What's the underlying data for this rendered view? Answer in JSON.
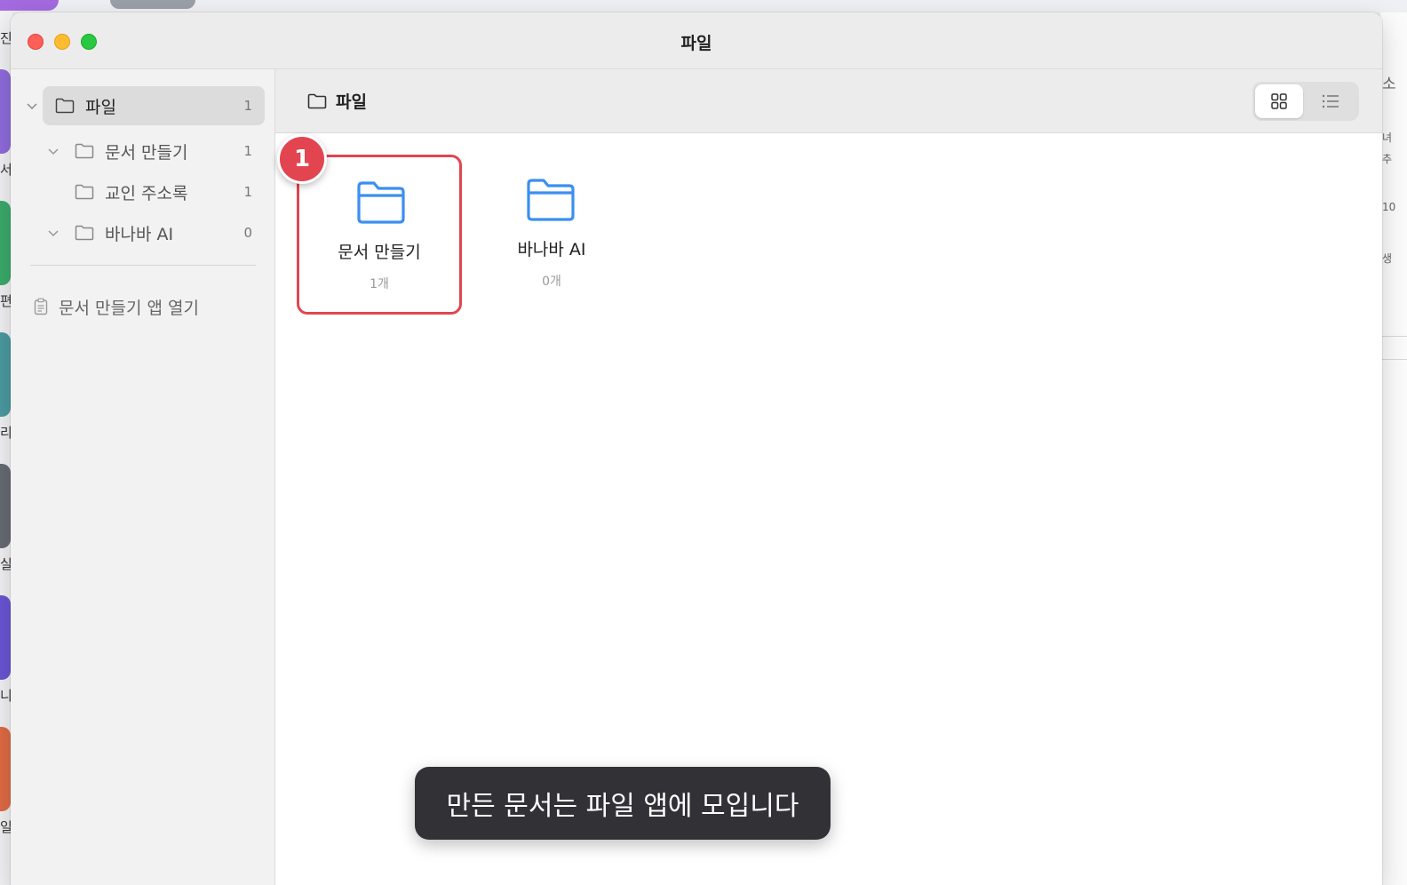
{
  "window": {
    "title": "파일"
  },
  "sidebar": {
    "root": {
      "label": "파일",
      "count": "1"
    },
    "items": [
      {
        "label": "문서 만들기",
        "count": "1"
      },
      {
        "label": "교인 주소록",
        "count": "1"
      },
      {
        "label": "바나바 AI",
        "count": "0"
      }
    ],
    "open_app": "문서 만들기 앱 열기"
  },
  "main": {
    "breadcrumb": "파일",
    "view_modes": [
      "grid-icon",
      "list-icon"
    ],
    "folders": [
      {
        "name": "문서 만들기",
        "count": "1개"
      },
      {
        "name": "바나바 AI",
        "count": "0개"
      }
    ]
  },
  "tutorial": {
    "step": "1",
    "toast": "만든 문서는 파일 앱에 모입니다"
  },
  "background": {
    "left_chars": [
      "진",
      "서",
      "편",
      "리",
      "실",
      "니",
      "일"
    ],
    "right_chars": [
      "소",
      "녀",
      "추",
      "10",
      "생"
    ]
  },
  "colors": {
    "accent_red": "#e24550",
    "folder_blue": "#3b8ff0",
    "toast_bg": "#323236"
  }
}
